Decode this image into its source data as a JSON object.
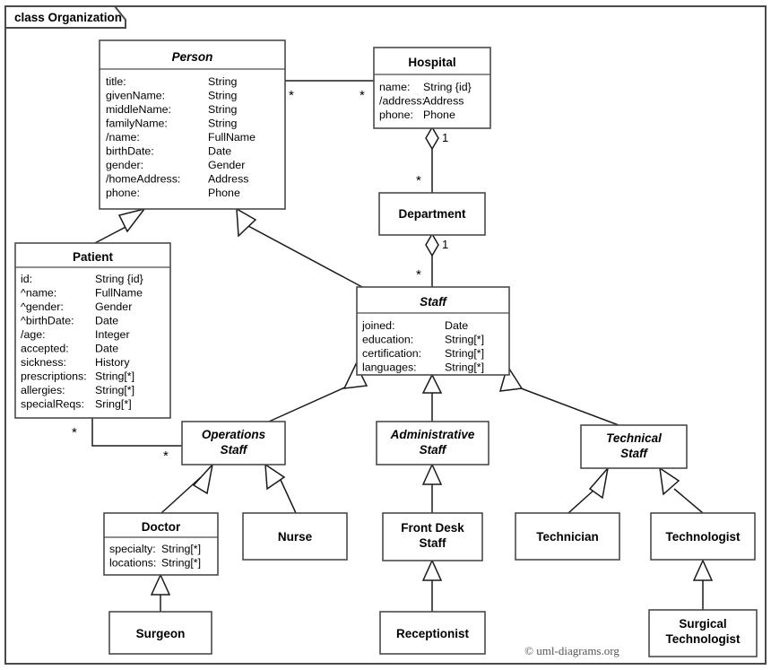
{
  "diagram": {
    "frame_label": "class Organization",
    "copyright": "© uml-diagrams.org",
    "colors": {
      "background": "#ffffff",
      "frame_stroke": "#4a4a4a",
      "box_stroke": "#4a4a4a",
      "line_stroke": "#1a1a1a",
      "text": "#000000",
      "copyright_text": "#555555"
    }
  },
  "classes": {
    "person": {
      "name": "Person",
      "abstract": true,
      "attributes": [
        {
          "name": "title:",
          "type": "String"
        },
        {
          "name": "givenName:",
          "type": "String"
        },
        {
          "name": "middleName:",
          "type": "String"
        },
        {
          "name": "familyName:",
          "type": "String"
        },
        {
          "name": "/name:",
          "type": "FullName"
        },
        {
          "name": "birthDate:",
          "type": "Date"
        },
        {
          "name": "gender:",
          "type": "Gender"
        },
        {
          "name": "/homeAddress:",
          "type": "Address"
        },
        {
          "name": "phone:",
          "type": "Phone"
        }
      ]
    },
    "hospital": {
      "name": "Hospital",
      "abstract": false,
      "attributes": [
        {
          "name": "name:",
          "type": "String {id}"
        },
        {
          "name": "/address:",
          "type": "Address"
        },
        {
          "name": "phone:",
          "type": "Phone"
        }
      ]
    },
    "department": {
      "name": "Department",
      "abstract": false,
      "attributes": []
    },
    "patient": {
      "name": "Patient",
      "abstract": false,
      "attributes": [
        {
          "name": "id:",
          "type": "String {id}"
        },
        {
          "name": "^name:",
          "type": "FullName"
        },
        {
          "name": "^gender:",
          "type": "Gender"
        },
        {
          "name": "^birthDate:",
          "type": "Date"
        },
        {
          "name": "/age:",
          "type": "Integer"
        },
        {
          "name": "accepted:",
          "type": "Date"
        },
        {
          "name": "sickness:",
          "type": "History"
        },
        {
          "name": "prescriptions:",
          "type": "String[*]"
        },
        {
          "name": "allergies:",
          "type": "String[*]"
        },
        {
          "name": "specialReqs:",
          "type": "Sring[*]"
        }
      ]
    },
    "staff": {
      "name": "Staff",
      "abstract": true,
      "attributes": [
        {
          "name": "joined:",
          "type": "Date"
        },
        {
          "name": "education:",
          "type": "String[*]"
        },
        {
          "name": "certification:",
          "type": "String[*]"
        },
        {
          "name": "languages:",
          "type": "String[*]"
        }
      ]
    },
    "operations_staff": {
      "name_line1": "Operations",
      "name_line2": "Staff",
      "abstract": true
    },
    "administrative_staff": {
      "name_line1": "Administrative",
      "name_line2": "Staff",
      "abstract": true
    },
    "technical_staff": {
      "name_line1": "Technical",
      "name_line2": "Staff",
      "abstract": true
    },
    "doctor": {
      "name": "Doctor",
      "abstract": false,
      "attributes": [
        {
          "name": "specialty:",
          "type": "String[*]"
        },
        {
          "name": "locations:",
          "type": "String[*]"
        }
      ]
    },
    "nurse": {
      "name": "Nurse",
      "abstract": false
    },
    "front_desk_staff": {
      "name_line1": "Front Desk",
      "name_line2": "Staff",
      "abstract": false
    },
    "technician": {
      "name": "Technician",
      "abstract": false
    },
    "technologist": {
      "name": "Technologist",
      "abstract": false
    },
    "surgeon": {
      "name": "Surgeon",
      "abstract": false
    },
    "receptionist": {
      "name": "Receptionist",
      "abstract": false
    },
    "surgical_technologist": {
      "name_line1": "Surgical",
      "name_line2": "Technologist",
      "abstract": false
    }
  },
  "multiplicities": {
    "person_to_hospital_person_end": "*",
    "person_to_hospital_hospital_end": "*",
    "hospital_department_hospital_end": "1",
    "hospital_department_department_end": "*",
    "department_staff_department_end": "1",
    "department_staff_staff_end": "*",
    "patient_operations_patient_end": "*",
    "patient_operations_staff_end": "*"
  }
}
